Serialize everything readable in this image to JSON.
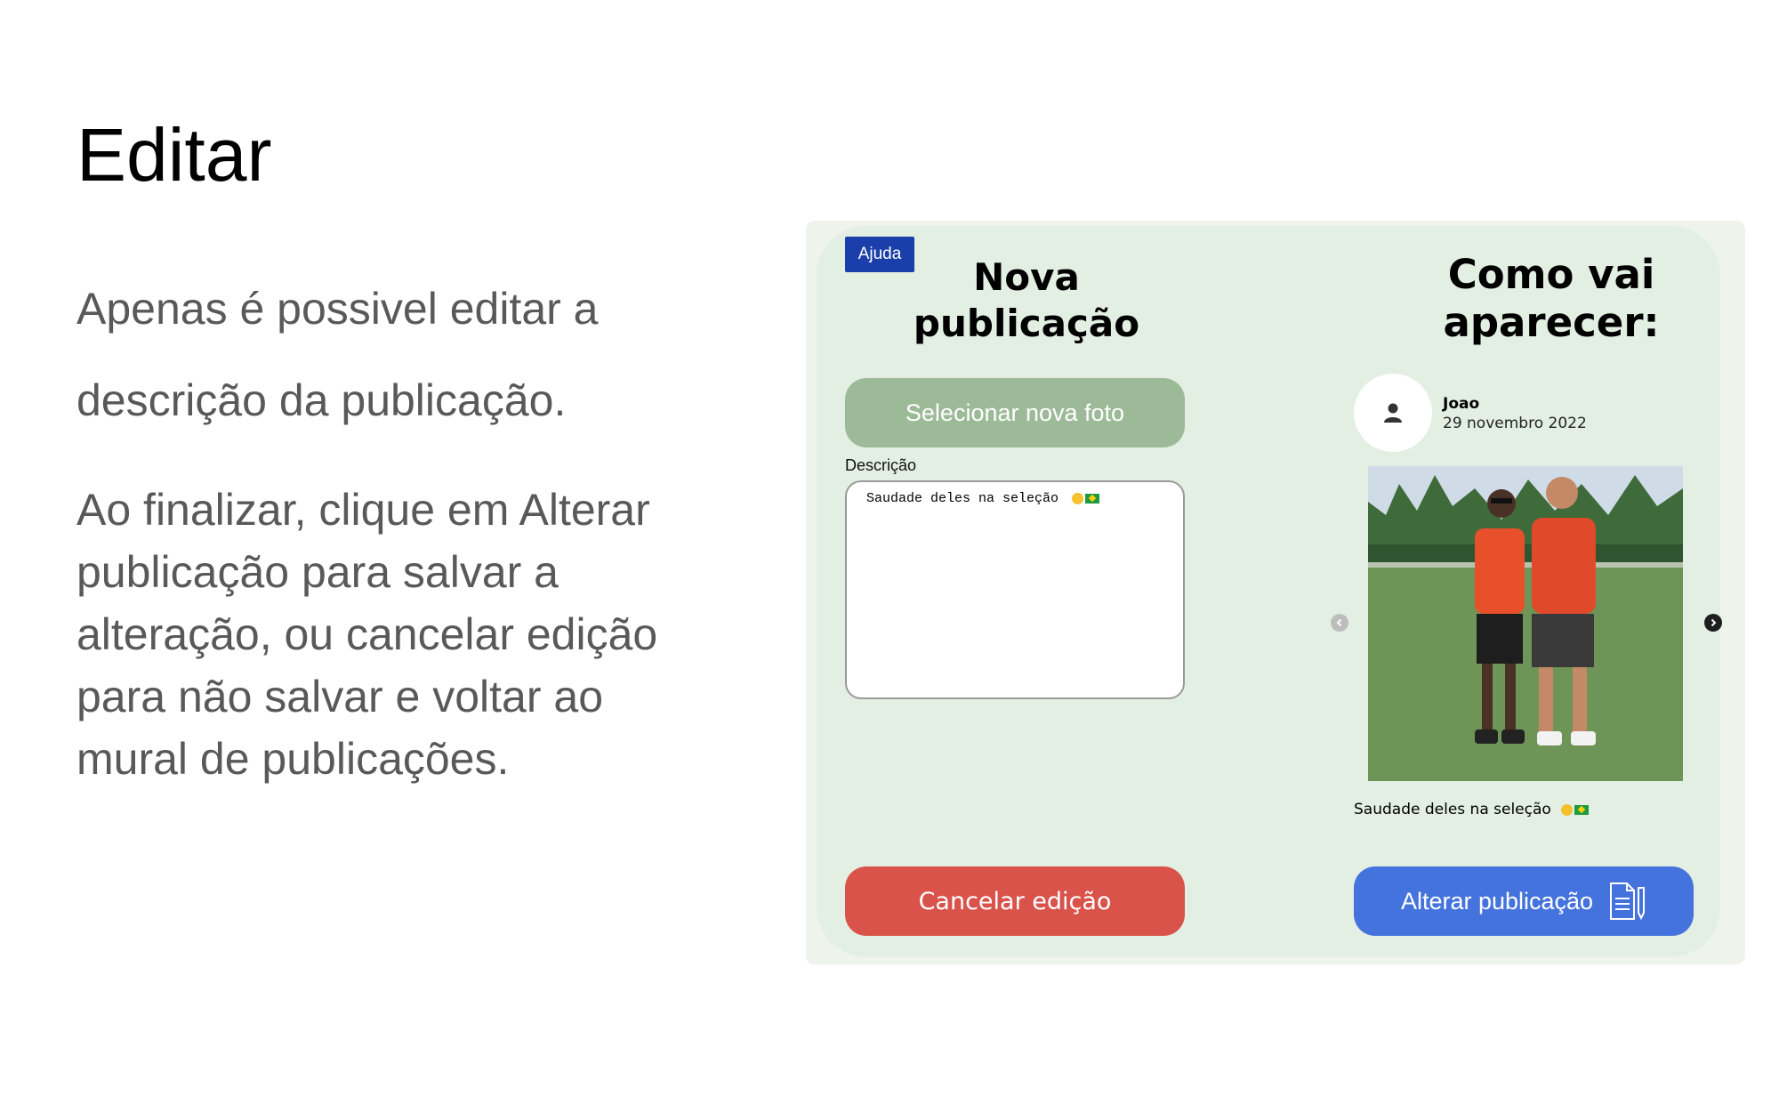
{
  "slide": {
    "title": "Editar",
    "paragraph1": "Apenas é possivel editar a descrição da publicação.",
    "paragraph2": "Ao finalizar, clique em Alterar publicação para salvar a alteração, ou cancelar edição para não salvar e voltar ao mural de publicações."
  },
  "form": {
    "help_label": "Ajuda",
    "title": "Nova publicação",
    "select_photo_label": "Selecionar nova foto",
    "description_label": "Descrição",
    "description_value": "Saudade deles na seleção",
    "cancel_label": "Cancelar edição"
  },
  "preview": {
    "title": "Como vai aparecer:",
    "user_name": "Joao",
    "date": "29 novembro 2022",
    "caption": "Saudade deles na seleção",
    "save_label": "Alterar publicação"
  },
  "icons": {
    "avatar": "user-icon",
    "prev": "chevron-left-icon",
    "next": "chevron-right-icon",
    "save": "document-edit-icon",
    "emojis": [
      "smiling-face-icon",
      "brazil-flag-icon"
    ]
  },
  "colors": {
    "help": "#1a3faa",
    "panel": "#e3efe3",
    "select_photo": "#9dba98",
    "cancel": "#d9534b",
    "save": "#4573dd"
  }
}
